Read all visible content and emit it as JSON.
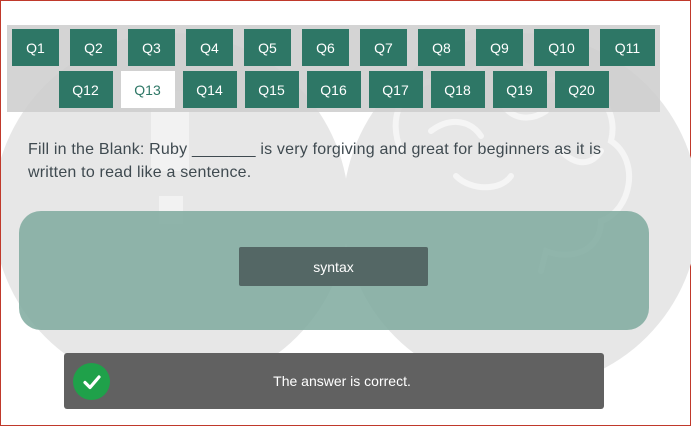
{
  "nav": {
    "row1": [
      "Q1",
      "Q2",
      "Q3",
      "Q4",
      "Q5",
      "Q6",
      "Q7",
      "Q8",
      "Q9",
      "Q10",
      "Q11"
    ],
    "row2": [
      "Q12",
      "Q13",
      "Q14",
      "Q15",
      "Q16",
      "Q17",
      "Q18",
      "Q19",
      "Q20"
    ],
    "active": "Q13"
  },
  "question": {
    "text": "Fill in the Blank: Ruby _______ is very forgiving and great for beginners as it is written to read like a sentence."
  },
  "answer": {
    "label": "syntax"
  },
  "feedback": {
    "text": "The answer is correct.",
    "icon": "check-icon"
  },
  "colors": {
    "button": "#2e7766",
    "panel": "#7ea99e",
    "answer_button": "#546765",
    "feedback_bg": "#616161",
    "success": "#1fa14a"
  }
}
